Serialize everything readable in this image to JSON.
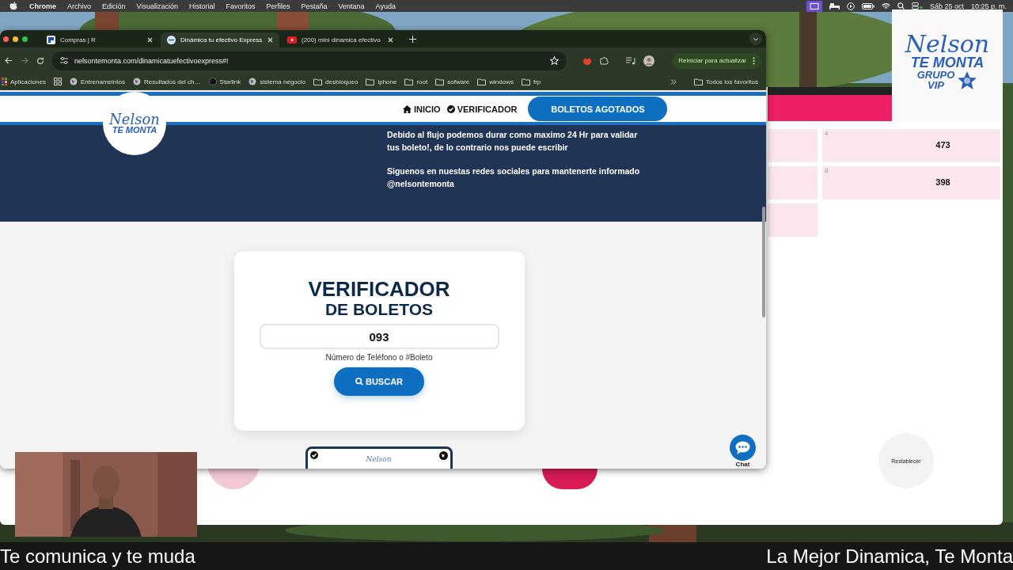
{
  "menu_bar": {
    "items": [
      {
        "label": "Chrome",
        "selected": true
      },
      {
        "label": "Archivo",
        "selected": false
      },
      {
        "label": "Edición",
        "selected": false
      },
      {
        "label": "Visualización",
        "selected": false
      },
      {
        "label": "Historial",
        "selected": false
      },
      {
        "label": "Favoritos",
        "selected": false
      },
      {
        "label": "Perfiles",
        "selected": false
      },
      {
        "label": "Pestaña",
        "selected": false
      },
      {
        "label": "Ventana",
        "selected": false
      },
      {
        "label": "Ayuda",
        "selected": false
      }
    ],
    "date": "Sáb 25 oct",
    "time": "10:25 p. m."
  },
  "browser": {
    "tabs": [
      {
        "title": "Compras | R",
        "kind": "r",
        "selected": false
      },
      {
        "title": "Dinámica tu efectivo Express",
        "kind": "site",
        "selected": true
      },
      {
        "title": "(200) mini dinamica efectivo",
        "kind": "video",
        "selected": false
      }
    ],
    "url": "nelsontemonta.com/dinamicatuefectivoexpress#!",
    "update_button": "Reiniciar para actualizar",
    "bookmarks": [
      {
        "label": "Aplicaciones",
        "kind": "apps"
      },
      {
        "label": "Entrenameintos",
        "kind": "globe"
      },
      {
        "label": "Resultados del ch…",
        "kind": "globe"
      },
      {
        "label": "Starlink",
        "kind": "dot"
      },
      {
        "label": "sistema negocio",
        "kind": "globe"
      },
      {
        "label": "desbloqueo",
        "kind": "folder"
      },
      {
        "label": "iphone",
        "kind": "folder"
      },
      {
        "label": "root",
        "kind": "folder"
      },
      {
        "label": "sofware",
        "kind": "folder"
      },
      {
        "label": "windows",
        "kind": "folder"
      },
      {
        "label": "frp",
        "kind": "folder"
      }
    ],
    "all_bookmarks": "Todos los favoritos"
  },
  "page": {
    "logo": {
      "script": "Nelson",
      "line": "TE MONTA"
    },
    "nav": [
      {
        "label": "INICIO",
        "kind": "home"
      },
      {
        "label": "VERIFICADOR",
        "kind": "check"
      }
    ],
    "cta": "BOLETOS AGOTADOS",
    "notice": [
      "Debido al flujo podemos durar como maximo 24 Hr para validar tus boleto!, de lo contrario nos puede escribir",
      "Siguenos en nuestas redes sociales para mantenerte informado @nelsontemonta"
    ],
    "verifier": {
      "title": "VERIFICADOR",
      "subtitle": "DE BOLETOS",
      "value": "093",
      "hint": "Número de Teléfono o #Boleto",
      "button": "BUSCAR"
    },
    "ticket_logo": "Nelson",
    "chat": "Chat"
  },
  "back_window": {
    "cells": [
      {
        "index": "4",
        "value": "473"
      },
      {
        "index": "8",
        "value": "398"
      }
    ],
    "reset": "Restablecer"
  },
  "brand_card": {
    "script": "Nelson",
    "line": "TE MONTA",
    "group": "GRUPO",
    "vip": "VIP"
  },
  "ticker": [
    "Te comunica y te muda",
    "La Mejor Dinamica, Te Monta"
  ]
}
